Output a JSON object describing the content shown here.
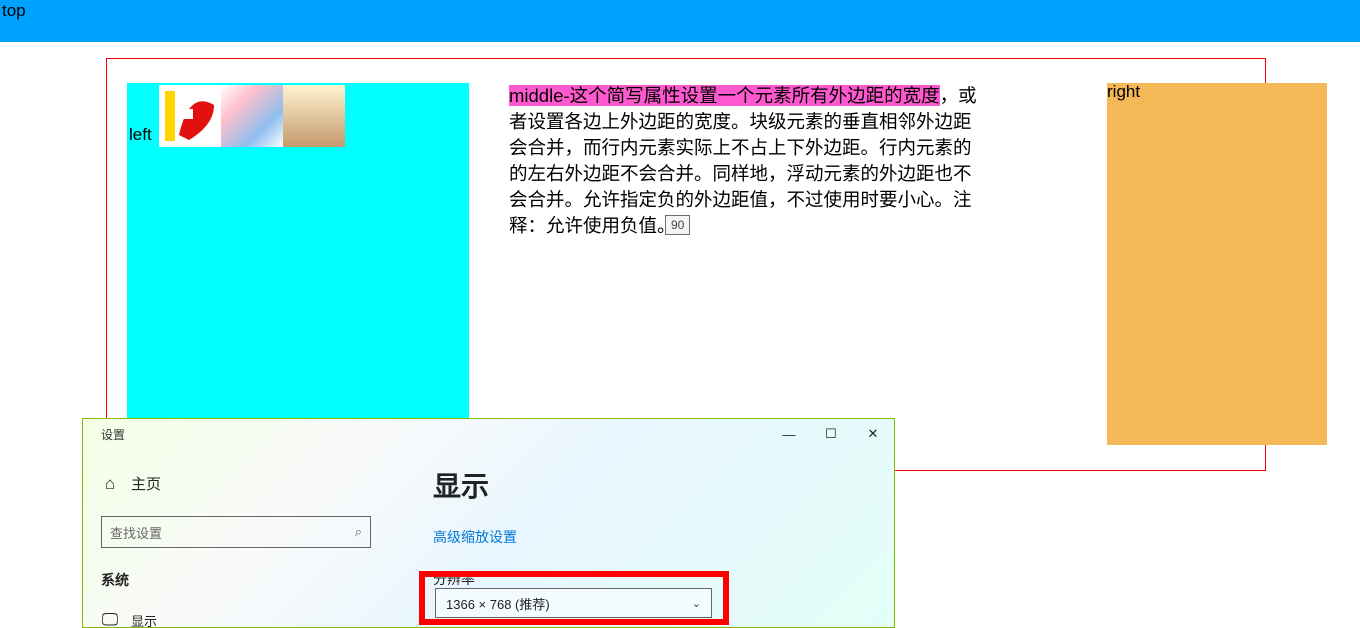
{
  "top_bar_label": "top",
  "tooltip_value": "90",
  "left": {
    "label": "left"
  },
  "middle": {
    "highlighted": "middle-这个简写属性设置一个元素所有外边距的宽度",
    "rest": "，或者设置各边上外边距的宽度。块级元素的垂直相邻外边距会合并，而行内元素实际上不占上下外边距。行内元素的的左右外边距不会合并。同样地，浮动元素的外边距也不会合并。允许指定负的外边距值，不过使用时要小心。注释：允许使用负值。"
  },
  "right": {
    "label": "right"
  },
  "settings": {
    "win_title": "设置",
    "home_label": "主页",
    "search_placeholder": "查找设置",
    "system_label": "系统",
    "display_menu": "显示",
    "display_heading": "显示",
    "advanced_link": "高级缩放设置",
    "resolution_label": "分辨率",
    "resolution_value": "1366 × 768 (推荐)",
    "win_buttons": {
      "min": "—",
      "max": "☐",
      "close": "✕"
    },
    "search_icon": "⌕"
  }
}
